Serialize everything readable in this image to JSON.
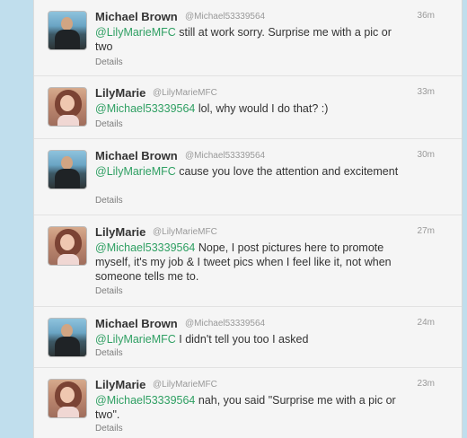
{
  "tweets": [
    {
      "name": "Michael Brown",
      "handle": "@Michael53339564",
      "time": "36m",
      "mention": "@LilyMarieMFC",
      "text": " still at work sorry.  Surprise me with a pic or two",
      "details": "Details"
    },
    {
      "name": "LilyMarie",
      "handle": "@LilyMarieMFC",
      "time": "33m",
      "mention": "@Michael53339564",
      "text": " lol, why would I do that? :)",
      "details": "Details"
    },
    {
      "name": "Michael Brown",
      "handle": "@Michael53339564",
      "time": "30m",
      "mention": "@LilyMarieMFC",
      "text": " cause you love the attention and excitement",
      "details": "Details"
    },
    {
      "name": "LilyMarie",
      "handle": "@LilyMarieMFC",
      "time": "27m",
      "mention": "@Michael53339564",
      "text": " Nope, I post pictures here to promote myself, it's my job & I tweet pics when I feel like it, not when someone tells me to.",
      "details": "Details"
    },
    {
      "name": "Michael Brown",
      "handle": "@Michael53339564",
      "time": "24m",
      "mention": "@LilyMarieMFC",
      "text": " I didn't tell you too I asked",
      "details": "Details"
    },
    {
      "name": "LilyMarie",
      "handle": "@LilyMarieMFC",
      "time": "23m",
      "mention": "@Michael53339564",
      "text": " nah, you said \"Surprise me with a pic or two\".",
      "details": "Details"
    }
  ]
}
